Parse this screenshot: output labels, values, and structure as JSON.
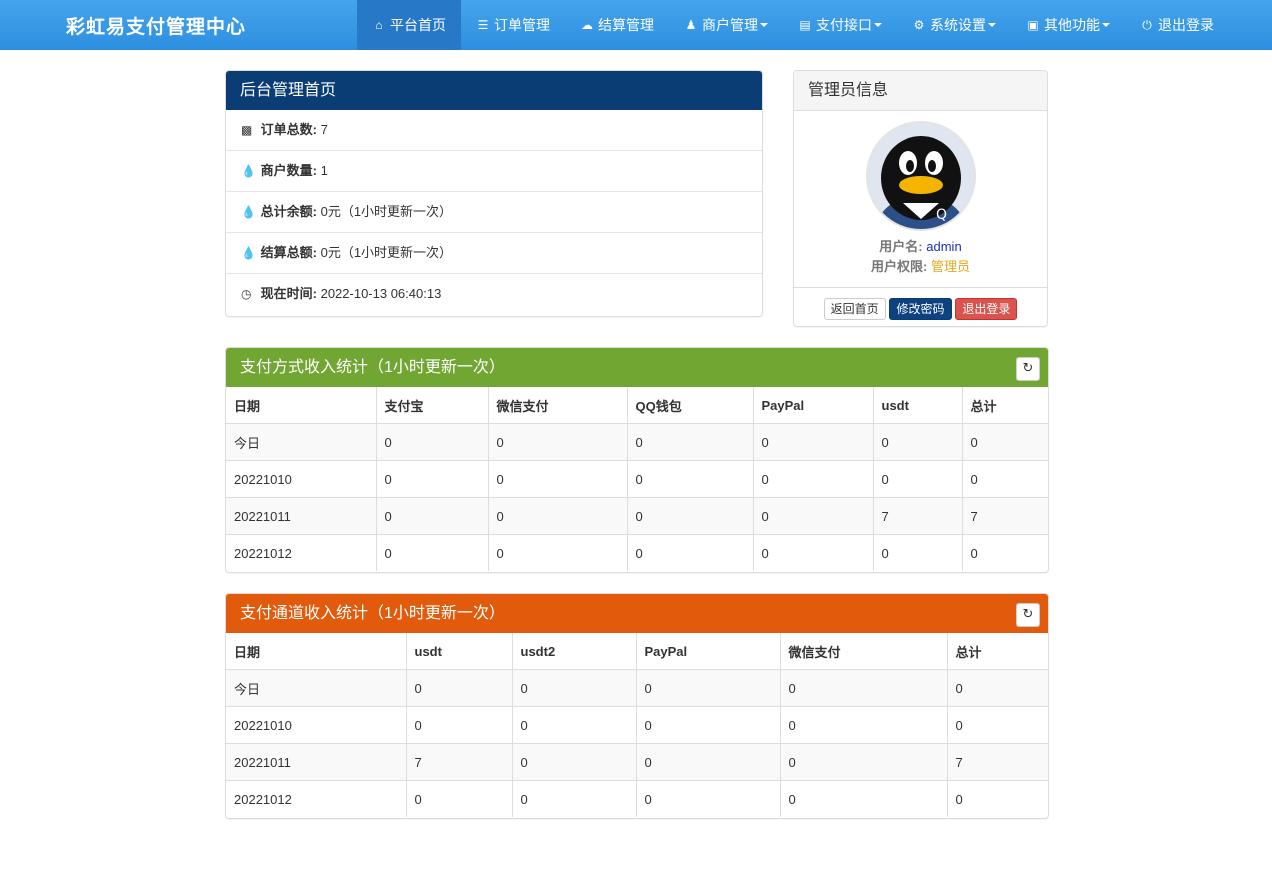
{
  "navbar": {
    "brand": "彩虹易支付管理中心",
    "items": [
      {
        "label": "平台首页"
      },
      {
        "label": "订单管理"
      },
      {
        "label": "结算管理"
      },
      {
        "label": "商户管理"
      },
      {
        "label": "支付接口"
      },
      {
        "label": "系统设置"
      },
      {
        "label": "其他功能"
      },
      {
        "label": "退出登录"
      }
    ]
  },
  "overview": {
    "title": "后台管理首页",
    "rows": [
      {
        "label": "订单总数:",
        "value": "7"
      },
      {
        "label": "商户数量:",
        "value": "1"
      },
      {
        "label": "总计余额:",
        "value": "0元（1小时更新一次）"
      },
      {
        "label": "结算总额:",
        "value": "0元（1小时更新一次）"
      },
      {
        "label": "现在时间:",
        "value": "2022-10-13 06:40:13"
      }
    ]
  },
  "admin": {
    "title": "管理员信息",
    "username_label": "用户名:",
    "username": "admin",
    "role_label": "用户权限:",
    "role": "管理员",
    "buttons": {
      "home": "返回首页",
      "change_password": "修改密码",
      "logout": "退出登录"
    },
    "username_color": "#1a2fbf",
    "role_color": "#e6a817"
  },
  "pay_method_stats": {
    "title": "支付方式收入统计（1小时更新一次）",
    "headers": [
      "日期",
      "支付宝",
      "微信支付",
      "QQ钱包",
      "PayPal",
      "usdt",
      "总计"
    ],
    "rows": [
      [
        "今日",
        "0",
        "0",
        "0",
        "0",
        "0",
        "0"
      ],
      [
        "20221010",
        "0",
        "0",
        "0",
        "0",
        "0",
        "0"
      ],
      [
        "20221011",
        "0",
        "0",
        "0",
        "0",
        "7",
        "7"
      ],
      [
        "20221012",
        "0",
        "0",
        "0",
        "0",
        "0",
        "0"
      ]
    ]
  },
  "pay_channel_stats": {
    "title": "支付通道收入统计（1小时更新一次）",
    "headers": [
      "日期",
      "usdt",
      "usdt2",
      "PayPal",
      "微信支付",
      "总计"
    ],
    "rows": [
      [
        "今日",
        "0",
        "0",
        "0",
        "0",
        "0"
      ],
      [
        "20221010",
        "0",
        "0",
        "0",
        "0",
        "0"
      ],
      [
        "20221011",
        "7",
        "0",
        "0",
        "0",
        "7"
      ],
      [
        "20221012",
        "0",
        "0",
        "0",
        "0",
        "0"
      ]
    ]
  }
}
